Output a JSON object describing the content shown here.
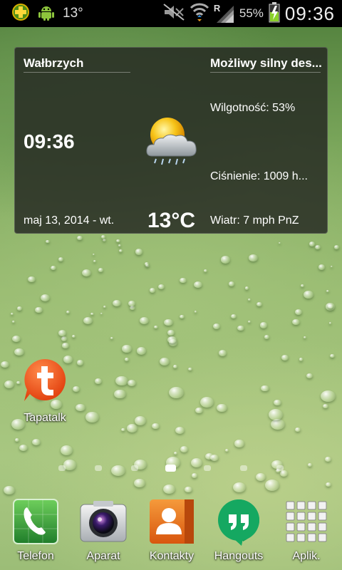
{
  "status_bar": {
    "icons_left": [
      "weather-app-notification-icon",
      "android-debug-icon"
    ],
    "temperature": "13°",
    "icons_right": [
      "mute-icon",
      "wifi-icon",
      "roaming-signal-icon",
      "battery-charging-icon"
    ],
    "roaming_letter": "R",
    "battery": "55%",
    "time": "09:36"
  },
  "weather_widget": {
    "city": "Wałbrzych",
    "condition": "Możliwy silny des...",
    "time": "09:36",
    "date": "maj 13, 2014 - wt.",
    "temperature": "13°C",
    "humidity": "Wilgotność: 53%",
    "pressure": "Ciśnienie: 1009 h...",
    "wind": "Wiatr: 7 mph PnZ",
    "icon": "sun-cloud-rain-icon"
  },
  "home_apps": [
    {
      "label": "Tapatalk",
      "icon": "tapatalk-icon"
    }
  ],
  "page_indicator": {
    "count": 7,
    "active_index": 3
  },
  "dock": [
    {
      "label": "Telefon",
      "icon": "phone-icon"
    },
    {
      "label": "Aparat",
      "icon": "camera-icon"
    },
    {
      "label": "Kontakty",
      "icon": "contacts-icon"
    },
    {
      "label": "Hangouts",
      "icon": "hangouts-icon"
    },
    {
      "label": "Aplik.",
      "icon": "apps-grid-icon"
    }
  ],
  "colors": {
    "status_bar_bg": "#000000",
    "widget_bg": "#232621",
    "tapatalk_orange": "#f0551e",
    "phone_green": "#3a9a3a",
    "contacts_orange": "#e8701a",
    "hangouts_green": "#0f9d58",
    "battery_green": "#8bd12a"
  }
}
